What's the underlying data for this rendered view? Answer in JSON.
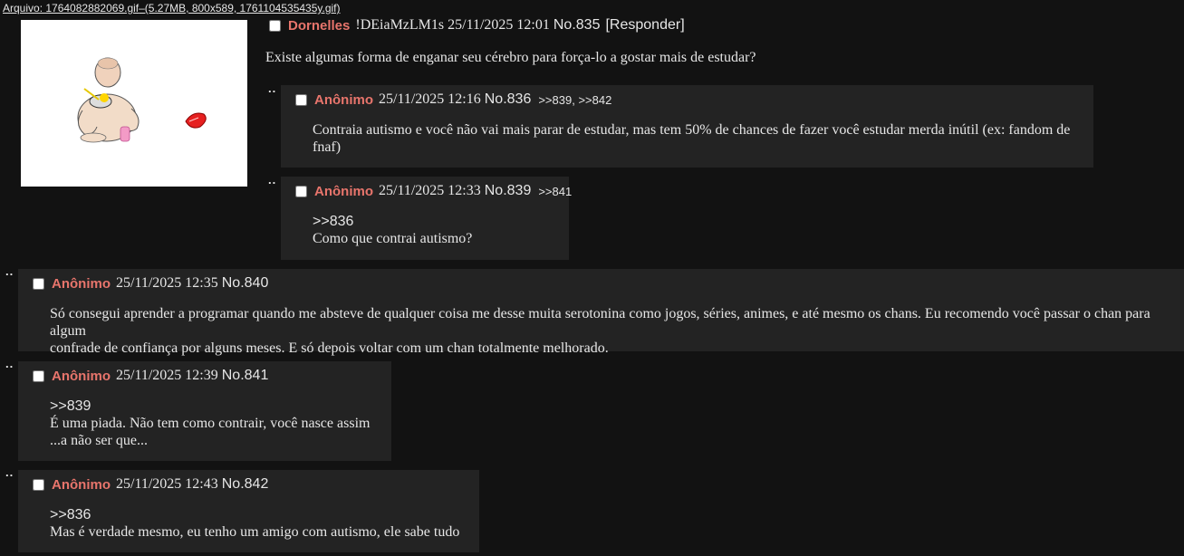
{
  "file": {
    "label": "Arquivo: 1764082882069.gif",
    "meta": "–(5.27MB, 800x589, 1761104535435y.gif)"
  },
  "op": {
    "name": "Dornelles",
    "tripcode": "!DEiaMzLM1s",
    "date": "25/11/2025 12:01",
    "number": "No.835",
    "reply_link": "[Responder]",
    "message": "Existe algumas forma de enganar seu cérebro para força-lo a gostar mais de estudar?"
  },
  "replies": [
    {
      "name": "Anônimo",
      "date": "25/11/2025 12:16",
      "number": "No.836",
      "backlinks": ">>839, >>842",
      "lines": [
        "Contraia autismo e você não vai mais parar de estudar, mas tem 50% de chances de fazer você estudar merda inútil (ex: fandom de",
        "fnaf)"
      ]
    },
    {
      "name": "Anônimo",
      "date": "25/11/2025 12:33",
      "number": "No.839",
      "backlinks": ">>841",
      "quote": ">>836",
      "lines": [
        "Como que contrai autismo?"
      ]
    },
    {
      "name": "Anônimo",
      "date": "25/11/2025 12:35",
      "number": "No.840",
      "lines": [
        "Só consegui aprender a programar quando me absteve de qualquer coisa me desse muita serotonina como jogos, séries, animes, e até mesmo os chans. Eu recomendo você passar o chan para algum",
        "confrade de confiança por alguns meses. E só depois voltar com um chan totalmente melhorado."
      ]
    },
    {
      "name": "Anônimo",
      "date": "25/11/2025 12:39",
      "number": "No.841",
      "quote": ">>839",
      "lines": [
        "É uma piada. Não tem como contrair, você nasce assim",
        "...a não ser que..."
      ]
    },
    {
      "name": "Anônimo",
      "date": "25/11/2025 12:43",
      "number": "No.842",
      "quote": ">>836",
      "lines": [
        "Mas é verdade mesmo, eu tenho um amigo com autismo, ele sabe tudo"
      ]
    }
  ],
  "dots": "..",
  "colors": {
    "background": "#121212",
    "reply_background": "#232323",
    "name": "#e8756c",
    "text": "#e6e6e6"
  },
  "thumbnail_icon": "cartoon-character-eating-image"
}
